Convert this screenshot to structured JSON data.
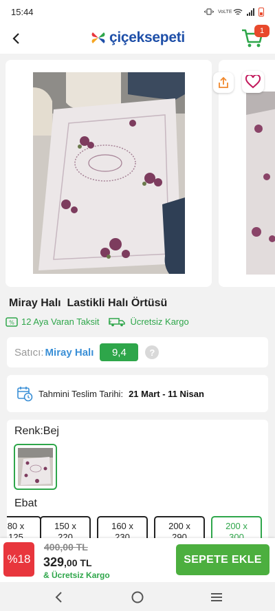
{
  "status_bar": {
    "time": "15:44",
    "network": "VoLTE",
    "battery_color": "#e8492c"
  },
  "header": {
    "back_icon": "back-arrow-icon",
    "logo_text": "çiçeksepeti",
    "cart_icon": "cart-icon",
    "cart_count": "1"
  },
  "gallery": {
    "share_icon": "share-icon",
    "favorite_icon": "heart-icon",
    "images": [
      "carpet-photo-1",
      "carpet-photo-2"
    ]
  },
  "product": {
    "title": "Miray Halı  Lastikli Halı Örtüsü",
    "installment": "12 Aya Varan Taksit",
    "shipping": "Ücretsiz Kargo"
  },
  "seller": {
    "label": "Satıcı:",
    "name": "Miray Halı",
    "score": "9,4",
    "help": "?"
  },
  "delivery": {
    "label": "Tahmini Teslim Tarihi:",
    "dates": "21 Mart - 11 Nisan"
  },
  "options": {
    "color_label": "Renk:Bej",
    "size_label": "Ebat",
    "sizes": [
      {
        "l1": "80 x",
        "l2": "125"
      },
      {
        "l1": "150 x",
        "l2": "220"
      },
      {
        "l1": "160 x",
        "l2": "230"
      },
      {
        "l1": "200 x",
        "l2": "290"
      },
      {
        "l1": "200 x",
        "l2": "300"
      }
    ],
    "selected_size_index": 4
  },
  "purchase": {
    "discount": "%18",
    "old_price": "400,00 TL",
    "new_price_main": "329",
    "new_price_rest": ",00 TL",
    "cargo_note": "& Ücretsiz Kargo",
    "add_to_cart": "SEPETE EKLE"
  },
  "colors": {
    "brand_green": "#2ea64a",
    "brand_blue": "#1e4fa8",
    "accent_red": "#e8363d"
  },
  "system_nav": {
    "icons": [
      "back-nav-icon",
      "home-nav-icon",
      "recents-nav-icon"
    ]
  }
}
